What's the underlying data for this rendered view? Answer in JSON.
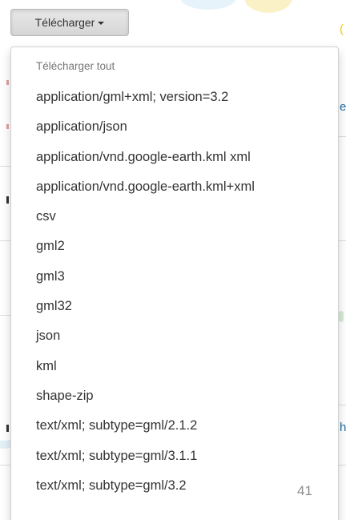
{
  "download_button": {
    "label": "Télécharger",
    "caret_icon": "caret-down-icon"
  },
  "dropdown_menu": {
    "header": "Télécharger tout",
    "items": [
      {
        "label": "application/gml+xml; version=3.2"
      },
      {
        "label": "application/json"
      },
      {
        "label": "application/vnd.google-earth.kml xml"
      },
      {
        "label": "application/vnd.google-earth.kml+xml"
      },
      {
        "label": "csv"
      },
      {
        "label": "gml2"
      },
      {
        "label": "gml3"
      },
      {
        "label": "gml32"
      },
      {
        "label": "json"
      },
      {
        "label": "kml"
      },
      {
        "label": "shape-zip"
      },
      {
        "label": "text/xml; subtype=gml/2.1.2"
      },
      {
        "label": "text/xml; subtype=gml/3.1.1"
      },
      {
        "label": "text/xml; subtype=gml/3.2"
      }
    ]
  },
  "page_number": "41",
  "colors": {
    "button_bg": "#dcdcdc",
    "menu_text": "#333333",
    "header_text": "#777777",
    "link_blue": "#1f6fa8"
  }
}
